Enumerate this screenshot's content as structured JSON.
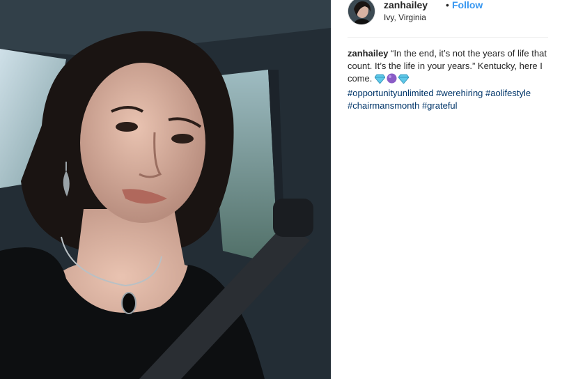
{
  "post": {
    "username": "zanhailey",
    "separator": "•",
    "follow_label": "Follow",
    "location": "Ivy, Virginia"
  },
  "caption": {
    "username": "zanhailey",
    "text": "“In the end, it’s not the years of life that count. It’s the life in your years.” Kentucky, here I come.",
    "emoji": [
      "gem-icon",
      "purple-circle-icon",
      "gem-icon"
    ],
    "hashtags": [
      "#opportunityunlimited",
      "#werehiring",
      "#aolifestyle",
      "#chairmansmonth",
      "#grateful"
    ]
  },
  "colors": {
    "follow": "#3897f0",
    "hashtag": "#003569",
    "text": "#262626",
    "divider": "#efefef"
  }
}
